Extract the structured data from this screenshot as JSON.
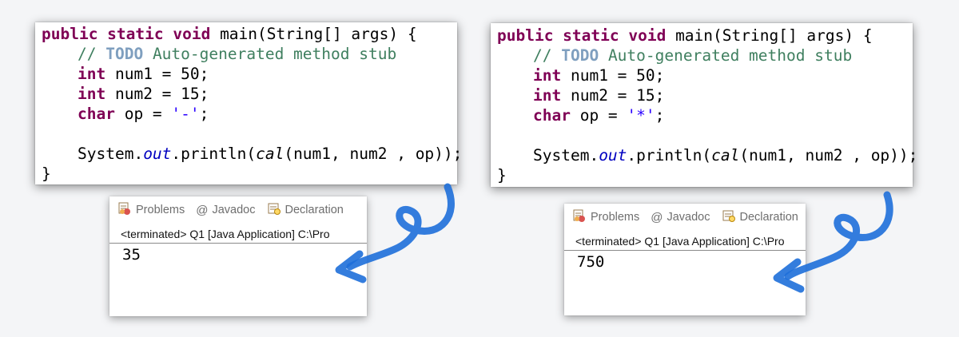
{
  "left": {
    "code": {
      "signature_kw": "public static void",
      "signature_rest": " main(String[] args) {",
      "comment_prefix": "// ",
      "comment_todo": "TODO",
      "comment_rest": " Auto-generated method stub",
      "decl1_type": "int",
      "decl1_rest": " num1 = 50;",
      "decl2_type": "int",
      "decl2_rest": " num2 = 15;",
      "decl3_type": "char",
      "decl3_mid": " op = ",
      "decl3_literal": "'-'",
      "decl3_end": ";",
      "print_prefix": "System.",
      "print_field": "out",
      "print_mid": ".println(",
      "print_method": "cal",
      "print_args": "(num1, num2 , op));",
      "closing_brace": "}"
    },
    "console": {
      "tab_problems": "Problems",
      "tab_javadoc": "Javadoc",
      "tab_declaration": "Declaration",
      "status": "<terminated> Q1 [Java Application] C:\\Pro",
      "output": "35"
    }
  },
  "right": {
    "code": {
      "signature_kw": "public static void",
      "signature_rest": " main(String[] args) {",
      "comment_prefix": "// ",
      "comment_todo": "TODO",
      "comment_rest": " Auto-generated method stub",
      "decl1_type": "int",
      "decl1_rest": " num1 = 50;",
      "decl2_type": "int",
      "decl2_rest": " num2 = 15;",
      "decl3_type": "char",
      "decl3_mid": " op = ",
      "decl3_literal": "'*'",
      "decl3_end": ";",
      "print_prefix": "System.",
      "print_field": "out",
      "print_mid": ".println(",
      "print_method": "cal",
      "print_args": "(num1, num2 , op));",
      "closing_brace": "}"
    },
    "console": {
      "tab_problems": "Problems",
      "tab_javadoc": "Javadoc",
      "tab_declaration": "Declaration",
      "status": "<terminated> Q1 [Java Application] C:\\Pro",
      "output": "750"
    }
  },
  "icons": {
    "problems": "problems-icon",
    "javadoc": "at-sign-icon",
    "declaration": "declaration-icon",
    "arrow": "curved-arrow-icon"
  },
  "colors": {
    "keyword": "#7f0055",
    "comment": "#3f7f5f",
    "todo": "#7f9fbf",
    "string": "#2a00ff",
    "field": "#0000c0",
    "arrow": "#1e6fd9"
  }
}
